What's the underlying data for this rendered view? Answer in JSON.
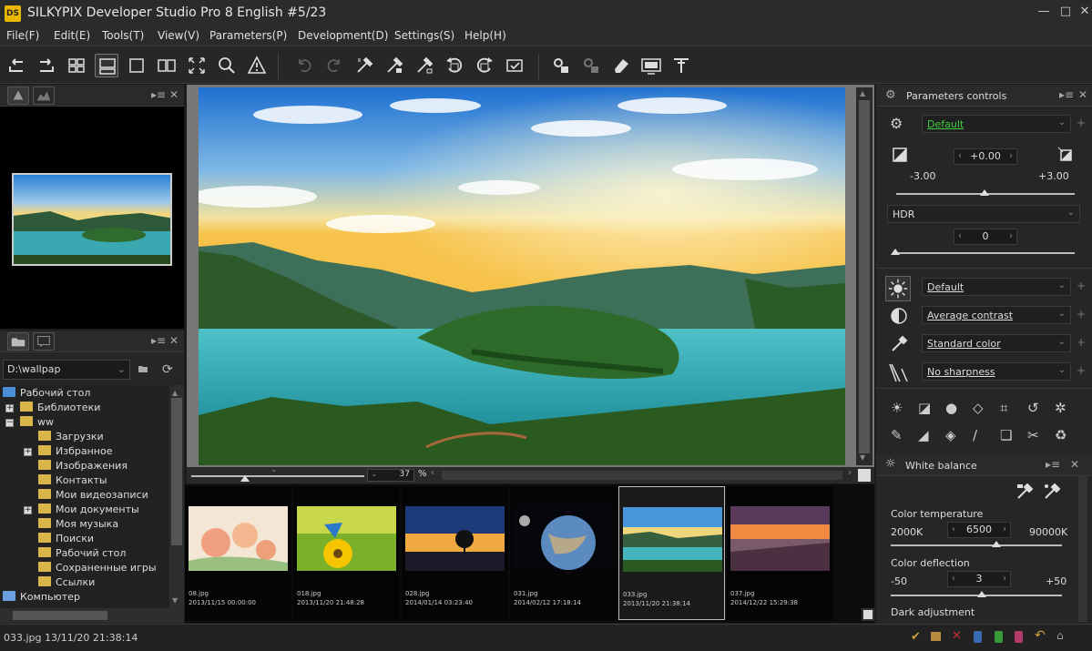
{
  "window": {
    "icon_text": "DS",
    "title": "SILKYPIX Developer Studio Pro 8 English   #5/23",
    "minimize": "—",
    "maximize": "□",
    "close": "✕"
  },
  "menu": [
    "File(F)",
    "Edit(E)",
    "Tools(T)",
    "View(V)",
    "Parameters(P)",
    "Development(D)",
    "Settings(S)",
    "Help(H)"
  ],
  "toolbar_icons": [
    "prev-icon",
    "next-icon",
    "thumbnail-grid-icon",
    "preview-thumbnail-icon",
    "single-view-icon",
    "compare-view-icon",
    "fullscreen-icon",
    "zoom-icon",
    "warning-icon",
    "undo-icon",
    "redo-icon",
    "paste-params-icon",
    "copy-params-icon",
    "paste-all-icon",
    "rotate-left-icon",
    "rotate-right-icon",
    "check-icon",
    "develop-icon",
    "batch-develop-icon",
    "eraser-icon",
    "monitor-icon",
    "tool-icon"
  ],
  "folder": {
    "path": "D:\\wallpap",
    "tree": [
      {
        "label": "Рабочий стол",
        "level": 0,
        "type": "desktop"
      },
      {
        "label": "Библиотеки",
        "level": 1,
        "type": "folder",
        "expander": "+"
      },
      {
        "label": "ww",
        "level": 1,
        "type": "folder",
        "expander": "−"
      },
      {
        "label": "Загрузки",
        "level": 2,
        "type": "folder"
      },
      {
        "label": "Избранное",
        "level": 2,
        "type": "folder",
        "expander": "+"
      },
      {
        "label": "Изображения",
        "level": 2,
        "type": "folder"
      },
      {
        "label": "Контакты",
        "level": 2,
        "type": "folder"
      },
      {
        "label": "Мои видеозаписи",
        "level": 2,
        "type": "folder"
      },
      {
        "label": "Мои документы",
        "level": 2,
        "type": "folder",
        "expander": "+"
      },
      {
        "label": "Моя музыка",
        "level": 2,
        "type": "folder"
      },
      {
        "label": "Поиски",
        "level": 2,
        "type": "folder"
      },
      {
        "label": "Рабочий стол",
        "level": 2,
        "type": "folder"
      },
      {
        "label": "Сохраненные игры",
        "level": 2,
        "type": "folder"
      },
      {
        "label": "Ссылки",
        "level": 2,
        "type": "folder"
      },
      {
        "label": "Компьютер",
        "level": 0,
        "type": "computer",
        "expander": "−"
      }
    ]
  },
  "zoom": {
    "value": "37",
    "unit": "%"
  },
  "filmstrip": [
    {
      "name": "08.jpg",
      "date": "2013/11/15 00:00:00",
      "theme": "roses"
    },
    {
      "name": "018.jpg",
      "date": "2013/11/20 21:48:28",
      "theme": "butterfly"
    },
    {
      "name": "028.jpg",
      "date": "2014/01/14 03:23:40",
      "theme": "tree"
    },
    {
      "name": "031.jpg",
      "date": "2014/02/12 17:18:14",
      "theme": "planet"
    },
    {
      "name": "033.jpg",
      "date": "2013/11/20 21:38:14",
      "theme": "lake",
      "selected": true
    },
    {
      "name": "037.jpg",
      "date": "2014/12/22 15:29:38",
      "theme": "sunset"
    }
  ],
  "params": {
    "title": "Parameters controls",
    "taste": "Default",
    "exposure": {
      "value": "+0.00",
      "min": "-3.00",
      "max": "+3.00"
    },
    "hdr": {
      "label": "HDR",
      "value": "0"
    },
    "tone": "Default",
    "contrast": "Average contrast",
    "color": "Standard color",
    "sharpness": "No sharpness"
  },
  "white_balance": {
    "title": "White balance",
    "temp_label": "Color temperature",
    "temp_min": "2000K",
    "temp_value": "6500",
    "temp_max": "90000K",
    "deflection_label": "Color deflection",
    "defl_min": "-50",
    "defl_value": "3",
    "defl_max": "+50",
    "dark_label": "Dark adjustment"
  },
  "status": {
    "text": "033.jpg 13/11/20 21:38:14"
  },
  "colors": {
    "accent_green": "#3ecf3e",
    "panel": "#262626",
    "background": "#1c1c1c"
  }
}
